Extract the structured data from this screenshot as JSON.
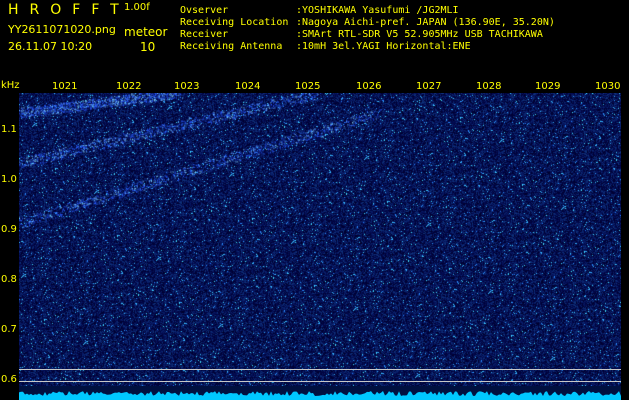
{
  "header": {
    "app_title": "HROFFT",
    "version": "1.00f",
    "filename": "YY2611071020.png",
    "mode_label": "meteor",
    "datetime": "26.11.07 10:20",
    "count": "10"
  },
  "info": {
    "rows": [
      {
        "label": "Ovserver",
        "value": ":YOSHIKAWA Yasufumi /JG2MLI"
      },
      {
        "label": "Receiving Location",
        "value": ":Nagoya Aichi-pref. JAPAN (136.90E, 35.20N)"
      },
      {
        "label": "Receiver",
        "value": ":SMArt RTL-SDR V5 52.905MHz USB TACHIKAWA"
      },
      {
        "label": "Receiving Antenna",
        "value": ":10mH 3el.YAGI Horizontal:ENE"
      }
    ]
  },
  "axes": {
    "y_unit": "kHz",
    "y_ticks": [
      "1.1",
      "1.0",
      "0.9",
      "0.8",
      "0.7",
      "0.6"
    ],
    "x_ticks": [
      "1021",
      "1022",
      "1023",
      "1024",
      "1025",
      "1026",
      "1027",
      "1028",
      "1029",
      "1030"
    ]
  },
  "colors": {
    "text": "#ffff00",
    "background": "#000000",
    "waterfall": "#00002a",
    "signal": "#1a3cff",
    "spectrum": "#00c8ff"
  }
}
